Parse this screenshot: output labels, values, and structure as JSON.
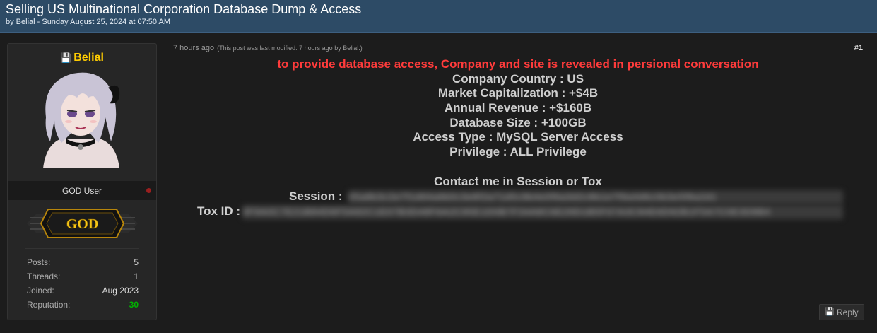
{
  "thread": {
    "title": "Selling US Multinational Corporation Database Dump & Access",
    "byline": "by Belial - Sunday August 25, 2024 at 07:50 AM"
  },
  "user": {
    "username": "Belial",
    "username_icon": "floppy-icon",
    "title": "GOD User",
    "rank_badge": "GOD",
    "stats": [
      {
        "label": "Posts:",
        "value": "5"
      },
      {
        "label": "Threads:",
        "value": "1"
      },
      {
        "label": "Joined:",
        "value": "Aug 2023"
      },
      {
        "label": "Reputation:",
        "value": "30"
      }
    ]
  },
  "post": {
    "time": "7 hours ago",
    "edited": "(This post was last modified: 7 hours ago by Belial.)",
    "number": "#1",
    "headline": "to provide database access, Company and site is revealed in persional conversation",
    "lines": [
      "Company Country : US",
      "Market Capitalization : +$4B",
      "Annual Revenue : +$160B",
      "Database Size : +100GB",
      "Access Type : MySQL Server Access",
      "Privilege : ALL Privilege"
    ],
    "contact_heading": "Contact me in Session or Tox",
    "session_label": "Session :",
    "tox_label": "Tox ID :",
    "reply_label": "Reply"
  },
  "colors": {
    "header_bg": "#2d4b66",
    "username": "#ffcc00",
    "headline_red": "#ff3b3b",
    "reputation_green": "#00b300"
  }
}
